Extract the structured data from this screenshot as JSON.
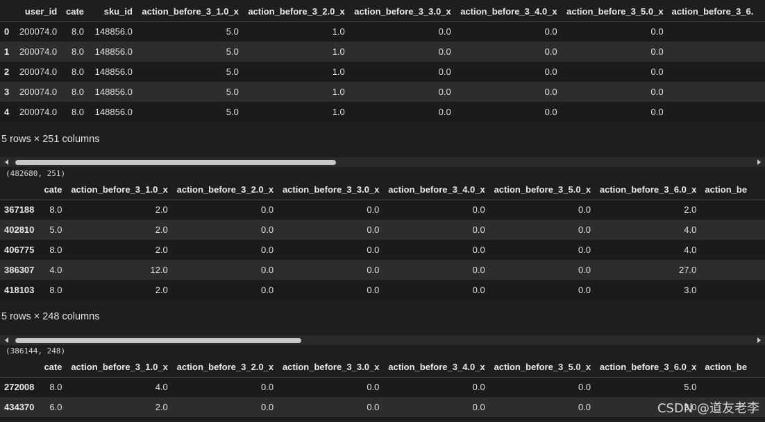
{
  "table1": {
    "columns": [
      "",
      "user_id",
      "cate",
      "sku_id",
      "action_before_3_1.0_x",
      "action_before_3_2.0_x",
      "action_before_3_3.0_x",
      "action_before_3_4.0_x",
      "action_before_3_5.0_x",
      "action_before_3_6."
    ],
    "rows": [
      [
        "0",
        "200074.0",
        "8.0",
        "148856.0",
        "5.0",
        "1.0",
        "0.0",
        "0.0",
        "0.0",
        ""
      ],
      [
        "1",
        "200074.0",
        "8.0",
        "148856.0",
        "5.0",
        "1.0",
        "0.0",
        "0.0",
        "0.0",
        ""
      ],
      [
        "2",
        "200074.0",
        "8.0",
        "148856.0",
        "5.0",
        "1.0",
        "0.0",
        "0.0",
        "0.0",
        ""
      ],
      [
        "3",
        "200074.0",
        "8.0",
        "148856.0",
        "5.0",
        "1.0",
        "0.0",
        "0.0",
        "0.0",
        ""
      ],
      [
        "4",
        "200074.0",
        "8.0",
        "148856.0",
        "5.0",
        "1.0",
        "0.0",
        "0.0",
        "0.0",
        ""
      ]
    ],
    "caption": "5 rows × 251 columns",
    "scroll_fraction": 0.44
  },
  "shape1": "(482680, 251)",
  "table2": {
    "columns": [
      "",
      "cate",
      "action_before_3_1.0_x",
      "action_before_3_2.0_x",
      "action_before_3_3.0_x",
      "action_before_3_4.0_x",
      "action_before_3_5.0_x",
      "action_before_3_6.0_x",
      "action_be"
    ],
    "rows": [
      [
        "367188",
        "8.0",
        "2.0",
        "0.0",
        "0.0",
        "0.0",
        "0.0",
        "2.0",
        ""
      ],
      [
        "402810",
        "5.0",
        "2.0",
        "0.0",
        "0.0",
        "0.0",
        "0.0",
        "4.0",
        ""
      ],
      [
        "406775",
        "8.0",
        "2.0",
        "0.0",
        "0.0",
        "0.0",
        "0.0",
        "4.0",
        ""
      ],
      [
        "386307",
        "4.0",
        "12.0",
        "0.0",
        "0.0",
        "0.0",
        "0.0",
        "27.0",
        ""
      ],
      [
        "418103",
        "8.0",
        "2.0",
        "0.0",
        "0.0",
        "0.0",
        "0.0",
        "3.0",
        ""
      ]
    ],
    "caption": "5 rows × 248 columns",
    "scroll_fraction": 0.4
  },
  "shape2": "(386144, 248)",
  "table3": {
    "columns": [
      "",
      "cate",
      "action_before_3_1.0_x",
      "action_before_3_2.0_x",
      "action_before_3_3.0_x",
      "action_before_3_4.0_x",
      "action_before_3_5.0_x",
      "action_before_3_6.0_x",
      "action_be"
    ],
    "rows": [
      [
        "272008",
        "8.0",
        "4.0",
        "0.0",
        "0.0",
        "0.0",
        "0.0",
        "5.0",
        ""
      ],
      [
        "434370",
        "6.0",
        "2.0",
        "0.0",
        "0.0",
        "0.0",
        "0.0",
        "3.0",
        ""
      ]
    ]
  },
  "watermark": "CSDN @道友老李",
  "colors": {
    "background": "#1e1e1e",
    "row_alt": "#2d2d2d",
    "scroll_thumb": "#c8c8c8"
  }
}
